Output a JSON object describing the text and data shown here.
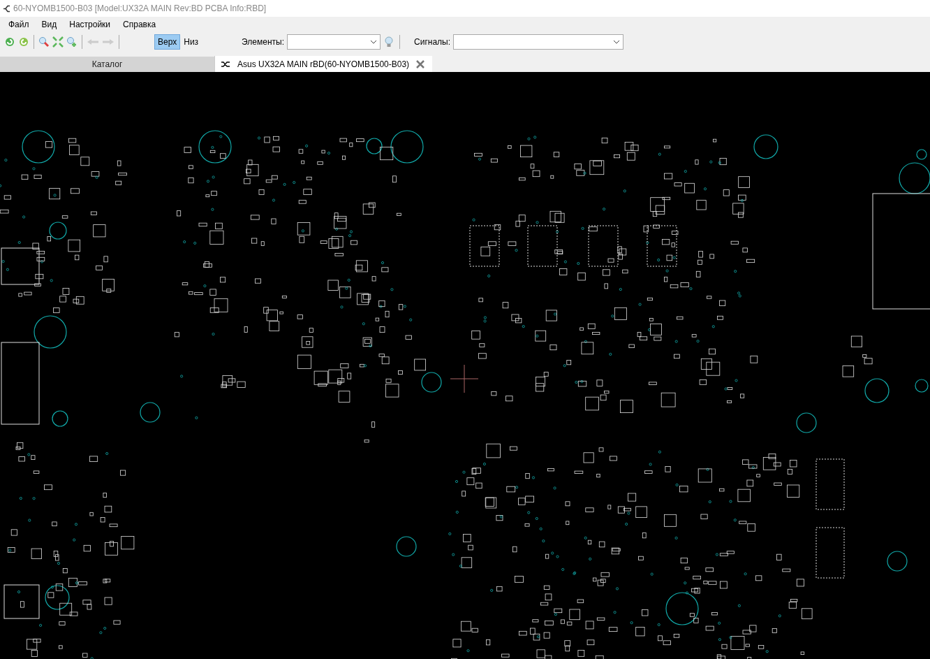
{
  "window": {
    "title": "60-NYOMB1500-B03 [Model:UX32A MAIN Rev:BD PCBA Info:RBD]"
  },
  "menu": [
    "Файл",
    "Вид",
    "Настройки",
    "Справка"
  ],
  "layers": [
    {
      "label": "Верх",
      "selected": true
    },
    {
      "label": "Низ",
      "selected": false
    }
  ],
  "elements_field": {
    "label": "Элементы:"
  },
  "signals_field": {
    "label": "Сигналы:"
  },
  "tabs": [
    {
      "label": "Каталог",
      "selected": false
    },
    {
      "label": "Asus UX32A MAIN rBD(60-NYOMB1500-B03)",
      "selected": true
    }
  ]
}
